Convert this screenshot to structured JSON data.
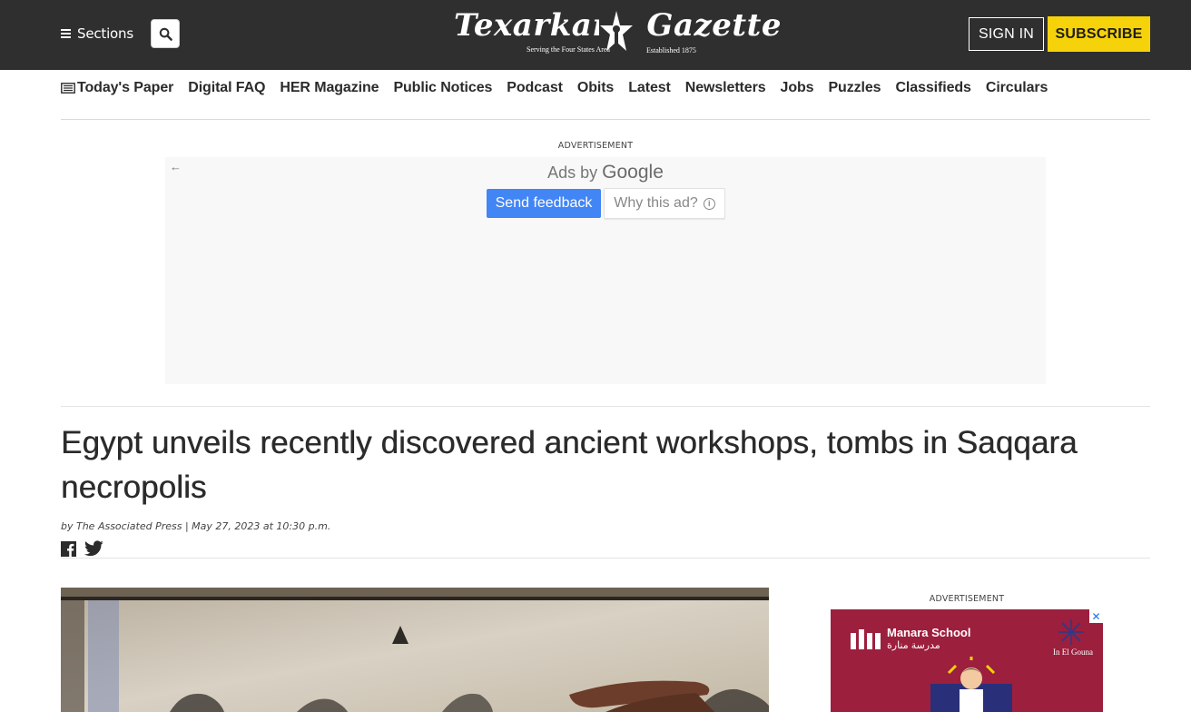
{
  "header": {
    "sections_label": "Sections",
    "logo": {
      "wordmark": "Texarkana Gazette",
      "tagline_left": "Serving the Four States Area",
      "tagline_right": "Established 1875"
    },
    "sign_in_label": "SIGN IN",
    "subscribe_label": "SUBSCRIBE",
    "colors": {
      "bar": "#2f2f2f",
      "subscribe": "#f5d20a"
    }
  },
  "nav": {
    "items": [
      {
        "label": "Today's Paper",
        "icon": "newspaper-icon"
      },
      {
        "label": "Digital FAQ"
      },
      {
        "label": "HER Magazine"
      },
      {
        "label": "Public Notices"
      },
      {
        "label": "Podcast"
      },
      {
        "label": "Obits"
      },
      {
        "label": "Latest"
      },
      {
        "label": "Newsletters"
      },
      {
        "label": "Jobs"
      },
      {
        "label": "Puzzles"
      },
      {
        "label": "Classifieds"
      },
      {
        "label": "Circulars"
      }
    ]
  },
  "top_ad": {
    "label": "ADVERTISEMENT",
    "ads_by": "Ads by",
    "google": "Google",
    "send_feedback": "Send feedback",
    "why_this_ad": "Why this ad?"
  },
  "article": {
    "headline": "Egypt unveils recently discovered ancient workshops, tombs in Saqqara necropolis",
    "byline": "by The Associated Press | May 27, 2023 at 10:30 p.m."
  },
  "side_ad": {
    "label": "ADVERTISEMENT",
    "school_name": "Manara School",
    "school_name_ar": "مدرسة منارة",
    "location": "In El Gouna",
    "background": "#9c1f3d"
  }
}
